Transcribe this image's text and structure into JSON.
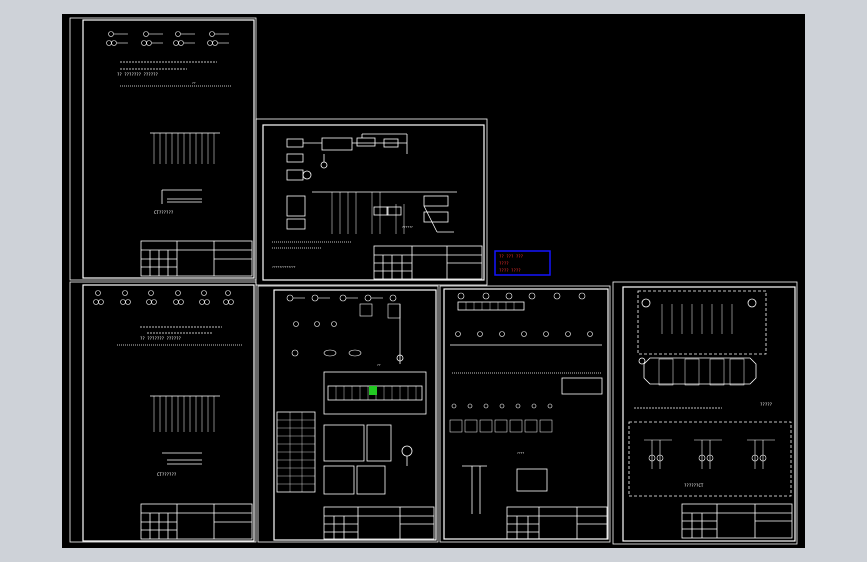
{
  "sheets": [
    {
      "id": "s1",
      "caption": "CT??????",
      "sub": "?? ??????? ??????",
      "dots": "??"
    },
    {
      "id": "s2",
      "caption": "??????",
      "note": "?????????????"
    },
    {
      "id": "s3",
      "caption": "CT??????",
      "sub": "?? ??????? ??????"
    },
    {
      "id": "s4",
      "caption": "??"
    },
    {
      "id": "s5",
      "caption": "????"
    },
    {
      "id": "s6",
      "caption": "??????CT",
      "note": "?????"
    }
  ],
  "stamp": {
    "lines": [
      "?? ??? ???",
      "????",
      "???? ????"
    ]
  },
  "colors": {
    "background": "#000000",
    "line": "#ffffff",
    "stamp_border": "#1414ff",
    "stamp_text": "#ff2a2a",
    "highlight": "#22c922"
  }
}
